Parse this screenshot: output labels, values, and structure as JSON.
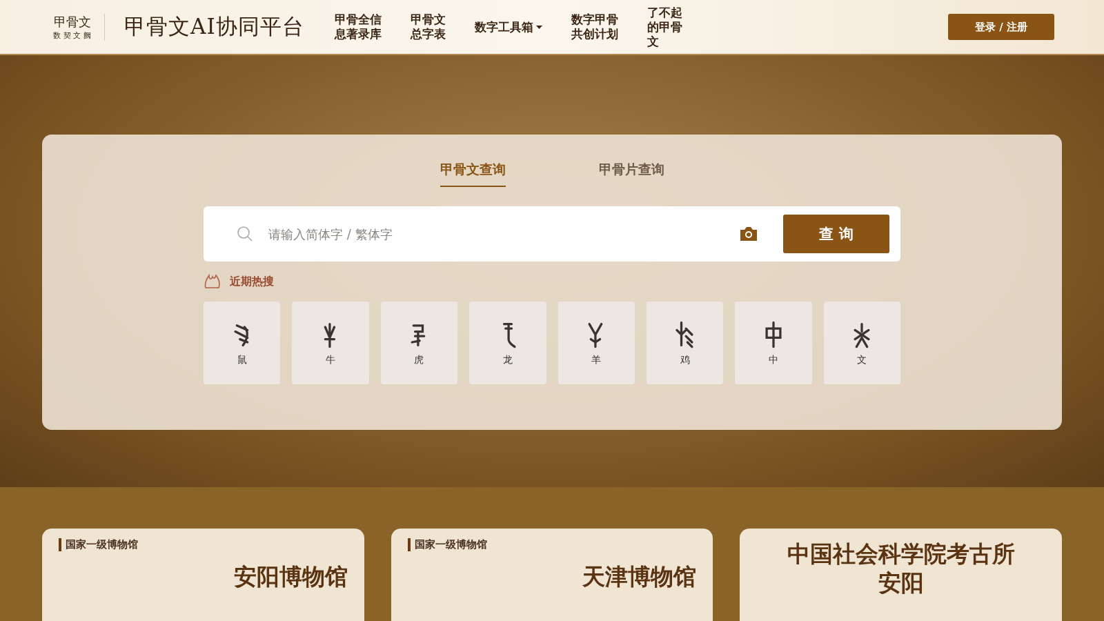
{
  "header": {
    "logo_lines": [
      "甲骨文",
      "数 契 文 阙"
    ],
    "title": "甲骨文AI协同平台",
    "nav": [
      {
        "label": "甲骨全信息著录库",
        "dropdown": false
      },
      {
        "label": "甲骨文总字表",
        "dropdown": false
      },
      {
        "label": "数字工具箱",
        "dropdown": true
      },
      {
        "label": "数字甲骨共创计划",
        "dropdown": false
      },
      {
        "label": "了不起的甲骨文",
        "dropdown": false
      }
    ],
    "login": "登录 / 注册"
  },
  "search": {
    "tabs": [
      {
        "label": "甲骨文查询",
        "selected": true
      },
      {
        "label": "甲骨片查询",
        "selected": false
      }
    ],
    "placeholder": "请输入简体字 / 繁体字",
    "button": "查 询",
    "hot_label": "近期热搜",
    "hot": [
      {
        "char": "鼠"
      },
      {
        "char": "牛"
      },
      {
        "char": "虎"
      },
      {
        "char": "龙"
      },
      {
        "char": "羊"
      },
      {
        "char": "鸡"
      },
      {
        "char": "中"
      },
      {
        "char": "文"
      }
    ]
  },
  "museums": [
    {
      "tag": "国家一级博物馆",
      "name": [
        "安阳博物馆"
      ]
    },
    {
      "tag": "国家一级博物馆",
      "name": [
        "天津博物馆"
      ]
    },
    {
      "name": [
        "中国社会科学院考古所",
        "安阳"
      ]
    }
  ]
}
